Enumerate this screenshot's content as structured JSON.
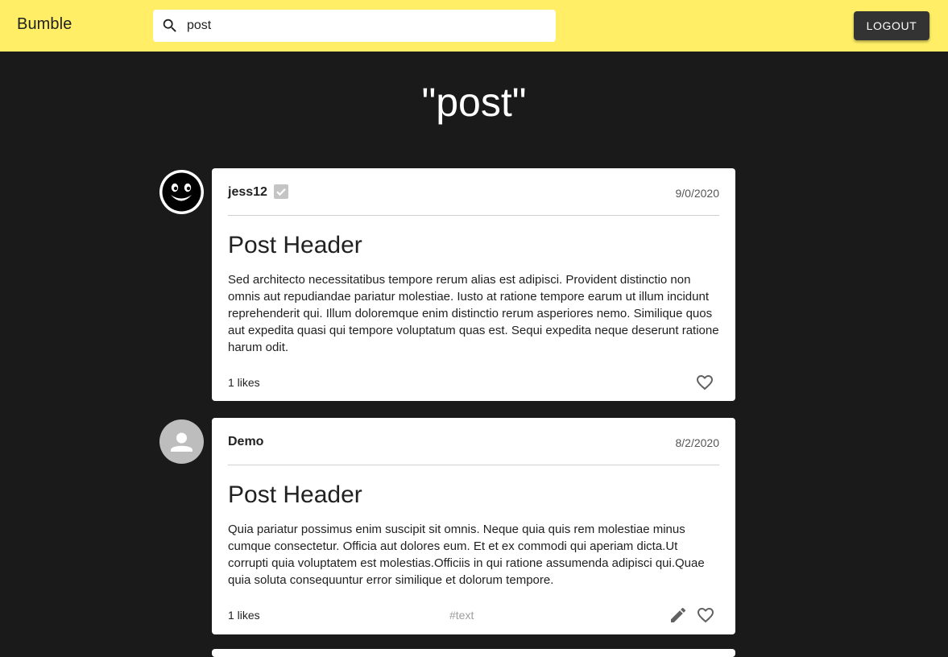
{
  "app": {
    "brand": "Bumble"
  },
  "search": {
    "value": "post"
  },
  "header": {
    "logout_label": "LOGOUT"
  },
  "page": {
    "title": "\"post\""
  },
  "posts": [
    {
      "author": "jess12",
      "verified": true,
      "date": "9/0/2020",
      "title": "Post Header",
      "body": "Sed architecto necessitatibus tempore rerum alias est adipisci. Provident distinctio non omnis aut repudiandae pariatur molestiae. Iusto at ratione tempore earum ut illum incidunt reprehenderit qui. Illum doloremque enim distinctio rerum asperiores nemo. Similique quos aut expedita quasi qui tempore voluptatum quas est. Sequi expedita neque deserunt ratione harum odit.",
      "likes": "1 likes",
      "tag": "",
      "avatar": "smiley-face-avatar",
      "actions": [
        "heart-icon"
      ]
    },
    {
      "author": "Demo",
      "verified": false,
      "date": "8/2/2020",
      "title": "Post Header",
      "body": "Quia pariatur possimus enim suscipit sit omnis. Neque quia quis rem molestiae minus cumque consectetur. Officia aut dolores eum. Et et ex commodi qui aperiam dicta.Ut corrupti quia voluptatem est molestias.Officiis in qui ratione assumenda adipisci qui.Quae quia soluta consequuntur error similique et dolorum tempore.",
      "likes": "1 likes",
      "tag": "#text",
      "avatar": "default-person-avatar",
      "actions": [
        "pencil-icon",
        "heart-icon"
      ]
    }
  ],
  "colors": {
    "topbar": "#ffee66",
    "background": "#1a1a1a",
    "card": "#ffffff",
    "logout_button": "#333333"
  }
}
